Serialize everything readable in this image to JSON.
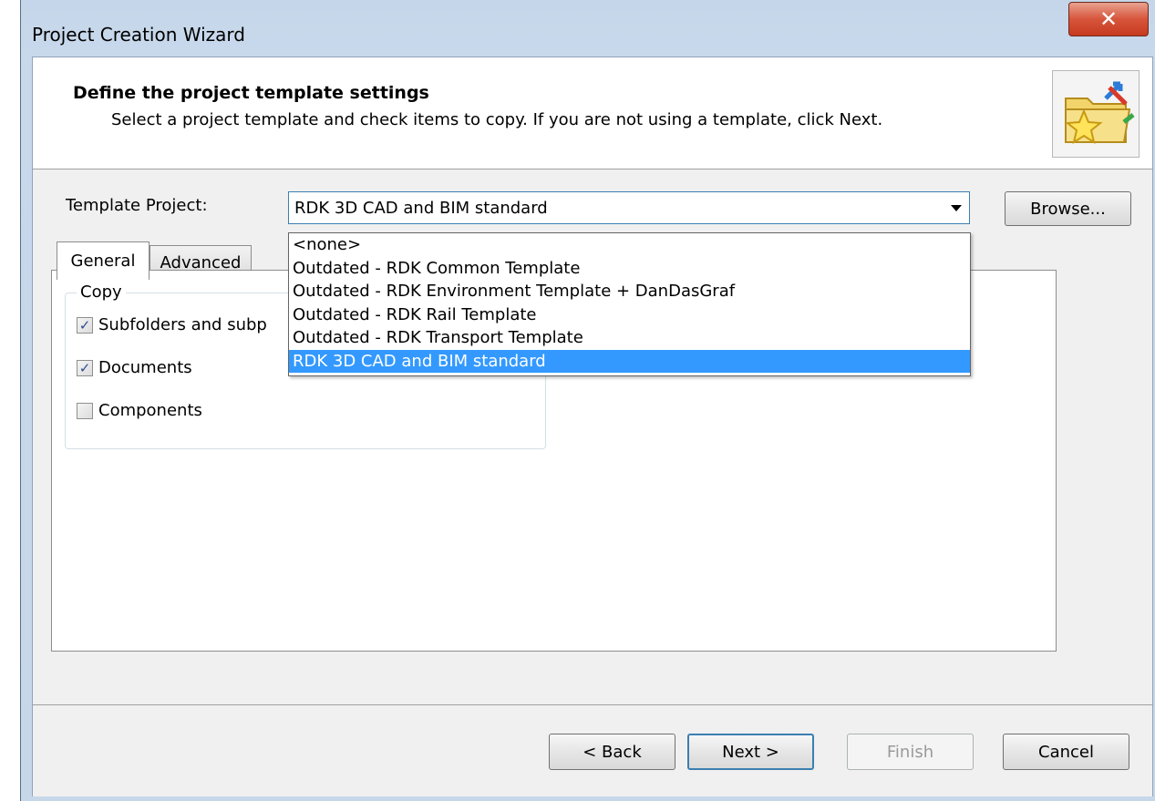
{
  "window": {
    "title": "Project Creation Wizard",
    "close_glyph": "✕"
  },
  "header": {
    "title": "Define the project template settings",
    "subtitle": "Select a project template and check items to copy.  If you are not using a template, click Next.",
    "icon": "wizard-folder-star-icon"
  },
  "template": {
    "label": "Template Project:",
    "selected": "RDK 3D CAD and BIM standard",
    "browse_label": "Browse...",
    "options": [
      "<none>",
      "Outdated - RDK Common Template",
      "Outdated - RDK Environment Template + DanDasGraf",
      "Outdated - RDK Rail Template",
      "Outdated - RDK Transport Template",
      "RDK 3D CAD and BIM standard"
    ],
    "highlighted_index": 5
  },
  "tabs": [
    {
      "label": "General",
      "active": true
    },
    {
      "label": "Advanced",
      "active": false
    }
  ],
  "copy_group": {
    "label": "Copy",
    "items": [
      {
        "label": "Subfolders and subp",
        "checked": true
      },
      {
        "label": "Documents",
        "checked": true
      },
      {
        "label": "Components",
        "checked": false
      }
    ]
  },
  "footer": {
    "back": "< Back",
    "next": "Next >",
    "finish": "Finish",
    "cancel": "Cancel"
  },
  "colors": {
    "selection": "#3399ff",
    "close_button": "#c63a1f"
  }
}
